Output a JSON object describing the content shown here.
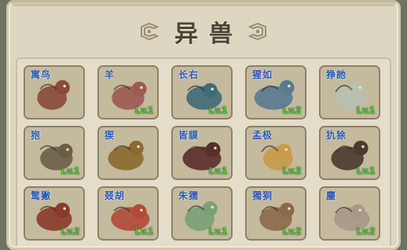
{
  "title": "异兽",
  "beasts": [
    {
      "name": "寓鸟",
      "level": "",
      "color": "#8a4a3a"
    },
    {
      "name": "羊",
      "level": "Lv.1",
      "color": "#9c5a52"
    },
    {
      "name": "长右",
      "level": "Lv.1",
      "color": "#3f6a78"
    },
    {
      "name": "猩如",
      "level": "Lv.2",
      "color": "#5a7a90"
    },
    {
      "name": "狰訑",
      "level": "Lv.1",
      "color": "#b8c0b0"
    },
    {
      "name": "狍",
      "level": "Lv.1",
      "color": "#6a6048"
    },
    {
      "name": "猰",
      "level": "",
      "color": "#8a6a30"
    },
    {
      "name": "皆貘",
      "level": "Lv.1",
      "color": "#5a2e2a"
    },
    {
      "name": "孟极",
      "level": "Lv.2",
      "color": "#c89a4a"
    },
    {
      "name": "犰狳",
      "level": "Lv.1",
      "color": "#4a3a30"
    },
    {
      "name": "鹜獙",
      "level": "Lv.2",
      "color": "#8a3a2a"
    },
    {
      "name": "叕胡",
      "level": "Lv.1",
      "color": "#b04a3a"
    },
    {
      "name": "朱獳",
      "level": "Lv.1",
      "color": "#7aa078"
    },
    {
      "name": "獨狪",
      "level": "Lv.2",
      "color": "#8a6a4a"
    },
    {
      "name": "麈",
      "level": "Lv.2",
      "color": "#a89888"
    }
  ]
}
